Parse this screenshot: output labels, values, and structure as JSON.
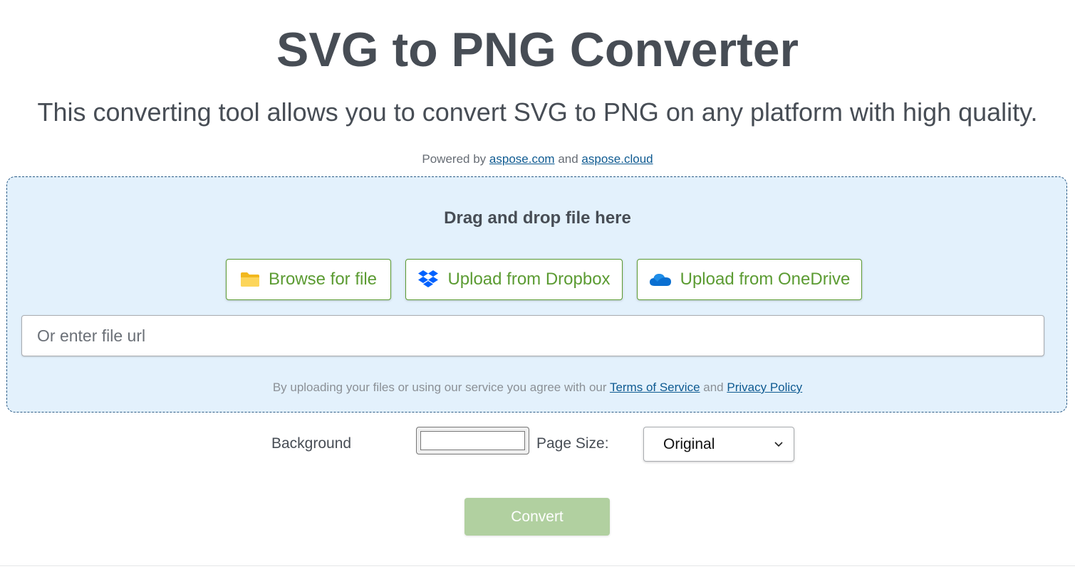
{
  "header": {
    "title": "SVG to PNG Converter",
    "subtitle": "This converting tool allows you to convert SVG to PNG on any platform with high quality."
  },
  "powered_by": {
    "prefix": "Powered by",
    "link1": "aspose.com",
    "and": "and",
    "link2": "aspose.cloud"
  },
  "upload": {
    "drop_title": "Drag and drop file here",
    "browse_label": "Browse for file",
    "dropbox_label": "Upload from Dropbox",
    "onedrive_label": "Upload from OneDrive",
    "url_placeholder": "Or enter file url",
    "url_value": "",
    "icons": {
      "browse": "folder-icon",
      "dropbox": "dropbox-icon",
      "onedrive": "onedrive-cloud-icon"
    }
  },
  "terms": {
    "prefix": "By uploading your files or using our service you agree with our",
    "tos": "Terms of Service",
    "and": "and",
    "privacy": "Privacy Policy"
  },
  "options": {
    "background_label": "Background",
    "background_color": "#ffffff",
    "page_size_label": "Page Size:",
    "page_size_value": "Original"
  },
  "actions": {
    "convert_label": "Convert"
  },
  "colors": {
    "accent_green": "#5b9b32",
    "convert_disabled": "#b1d0a0",
    "drop_zone_bg": "#e3f1fc",
    "link_blue": "#0e5a91"
  }
}
